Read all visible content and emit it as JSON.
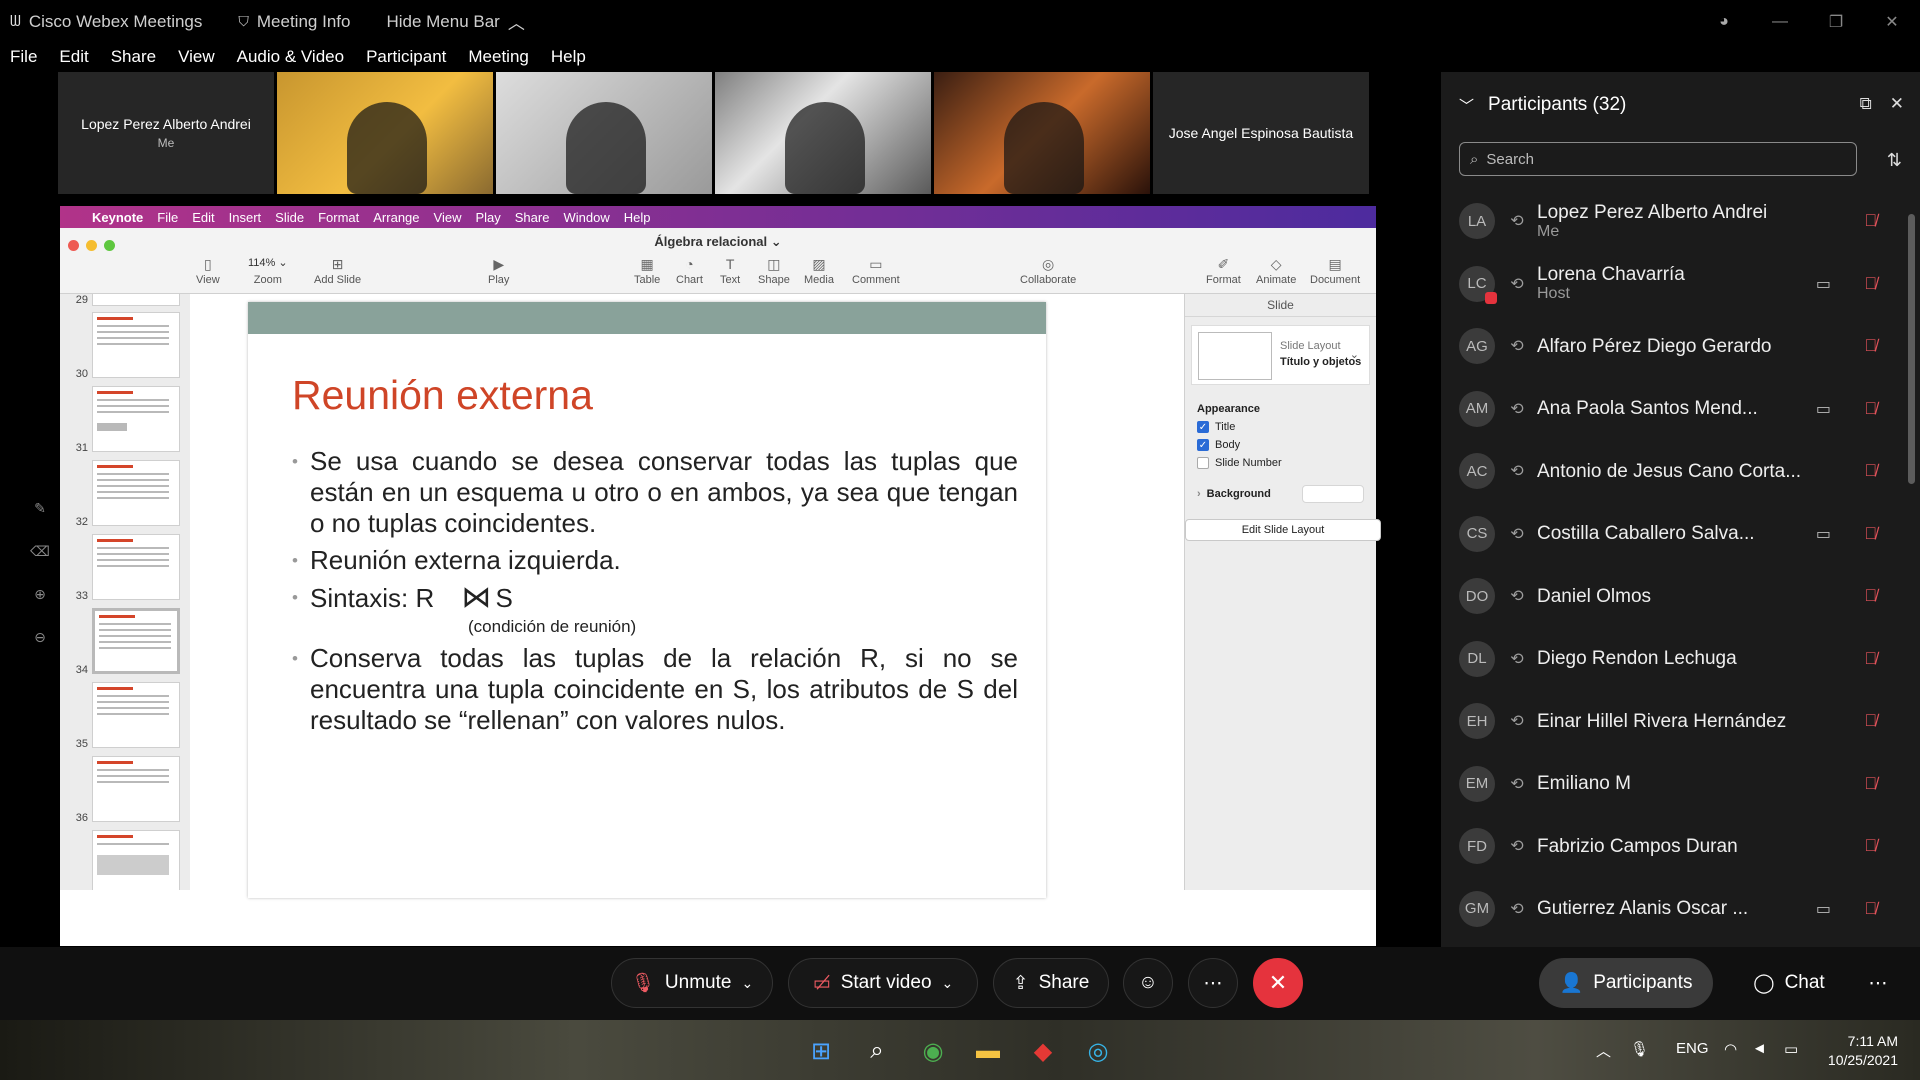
{
  "titlebar": {
    "app_name": "Cisco Webex Meetings",
    "meeting_info": "Meeting Info",
    "hide_menu": "Hide Menu Bar"
  },
  "menu": [
    "File",
    "Edit",
    "Share",
    "View",
    "Audio & Video",
    "Participant",
    "Meeting",
    "Help"
  ],
  "filmstrip": {
    "self_name": "Lopez Perez Alberto Andrei",
    "self_sub": "Me",
    "last_name": "Jose Angel Espinosa Bautista"
  },
  "keynote": {
    "menu": [
      "Keynote",
      "File",
      "Edit",
      "Insert",
      "Slide",
      "Format",
      "Arrange",
      "View",
      "Play",
      "Share",
      "Window",
      "Help"
    ],
    "doc_title": "Álgebra relacional ⌄",
    "toolbar": {
      "view": "View",
      "zoom_value": "114% ⌄",
      "zoom": "Zoom",
      "add_slide": "Add Slide",
      "play": "Play",
      "table": "Table",
      "chart": "Chart",
      "text": "Text",
      "shape": "Shape",
      "media": "Media",
      "comment": "Comment",
      "collaborate": "Collaborate",
      "format": "Format",
      "animate": "Animate",
      "document": "Document"
    },
    "slide_numbers": [
      "29",
      "30",
      "31",
      "32",
      "33",
      "34",
      "35",
      "36"
    ],
    "slide": {
      "title": "Reunión externa",
      "bullet1": "Se usa cuando se desea conservar todas las tuplas que están en un esquema u otro o en ambos, ya sea que tengan o no tuplas coincidentes.",
      "bullet2": "Reunión externa izquierda.",
      "bullet3_a": "Sintaxis:  R",
      "bullet3_sym": "⋈",
      "bullet3_b": "S",
      "bullet3_cond": "(condición de reunión)",
      "bullet4": "Conserva todas las tuplas de la relación R, si no se encuentra una tupla coincidente en S, los atributos de S del resultado se “rellenan” con valores nulos."
    },
    "inspector": {
      "header": "Slide",
      "layout_label": "Slide Layout",
      "layout_value": "Título y objetos",
      "appearance": "Appearance",
      "title_cb": "Title",
      "body_cb": "Body",
      "number_cb": "Slide Number",
      "background": "Background",
      "edit_layout": "Edit Slide Layout"
    }
  },
  "participants": {
    "header": "Participants (32)",
    "search_placeholder": "Search",
    "list": [
      {
        "initials": "LA",
        "name": "Lopez Perez Alberto Andrei",
        "role": "Me",
        "camera": false
      },
      {
        "initials": "LC",
        "name": "Lorena Chavarría",
        "role": "Host",
        "camera": true
      },
      {
        "initials": "AG",
        "name": "Alfaro Pérez Diego Gerardo",
        "role": "",
        "camera": false
      },
      {
        "initials": "AM",
        "name": "Ana Paola Santos Mend...",
        "role": "",
        "camera": true
      },
      {
        "initials": "AC",
        "name": "Antonio de Jesus Cano Corta...",
        "role": "",
        "camera": false
      },
      {
        "initials": "CS",
        "name": "Costilla Caballero Salva...",
        "role": "",
        "camera": true
      },
      {
        "initials": "DO",
        "name": "Daniel Olmos",
        "role": "",
        "camera": false
      },
      {
        "initials": "DL",
        "name": "Diego Rendon Lechuga",
        "role": "",
        "camera": false
      },
      {
        "initials": "EH",
        "name": "Einar Hillel Rivera Hernández",
        "role": "",
        "camera": false
      },
      {
        "initials": "EM",
        "name": "Emiliano M",
        "role": "",
        "camera": false
      },
      {
        "initials": "FD",
        "name": "Fabrizio Campos Duran",
        "role": "",
        "camera": false
      },
      {
        "initials": "GM",
        "name": "Gutierrez Alanis Oscar ...",
        "role": "",
        "camera": true
      }
    ]
  },
  "controls": {
    "unmute": "Unmute",
    "start_video": "Start video",
    "share": "Share",
    "participants": "Participants",
    "chat": "Chat"
  },
  "taskbar": {
    "lang": "ENG",
    "time": "7:11 AM",
    "date": "10/25/2021"
  },
  "colors": {
    "end_call": "#e5333d",
    "muted_mic": "#e5535b",
    "slide_title": "#cf4527",
    "keynote_menu_start": "#b13389",
    "keynote_menu_end": "#4d2b9e"
  }
}
